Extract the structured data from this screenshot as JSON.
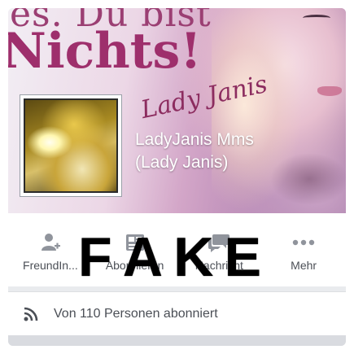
{
  "cover": {
    "line1": "es. Du bist",
    "line2": "Nichts!",
    "script": "Lady Janis"
  },
  "profile": {
    "name_line1": "LadyJanis Mms",
    "name_line2": "(Lady Janis)"
  },
  "actions": [
    {
      "label": "FreundIn...",
      "icon": "add-friend-icon"
    },
    {
      "label": "Abonnieren",
      "icon": "newsfeed-icon"
    },
    {
      "label": "Nachricht",
      "icon": "message-icon"
    },
    {
      "label": "Mehr",
      "icon": "more-icon"
    }
  ],
  "overlay": {
    "letters": [
      "F",
      "A",
      "K",
      "E"
    ]
  },
  "subscribers": {
    "text": "Von 110 Personen abonniert",
    "icon": "rss-icon"
  },
  "colors": {
    "icon_gray": "#90949c",
    "text_gray": "#4b4f56",
    "page_bg": "#e9ebee"
  }
}
